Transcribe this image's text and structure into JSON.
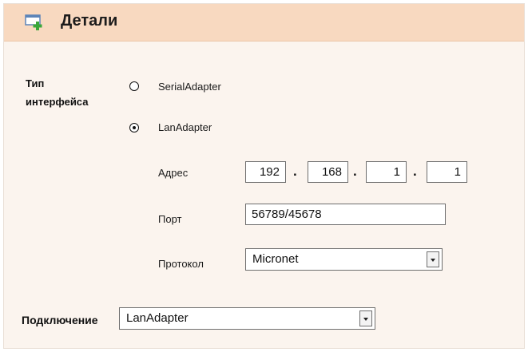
{
  "header": {
    "title": "Детали",
    "icon": "window-add-icon"
  },
  "interface_type": {
    "label_line1": "Тип",
    "label_line2": "интерфейса",
    "options": [
      {
        "label": "SerialAdapter",
        "selected": false
      },
      {
        "label": "LanAdapter",
        "selected": true
      }
    ]
  },
  "lan": {
    "address_label": "Адрес",
    "address": [
      "192",
      "168",
      "1",
      "1"
    ],
    "address_separator": ".",
    "port_label": "Порт",
    "port_value": "56789/45678",
    "protocol_label": "Протокол",
    "protocol_value": "Micronet"
  },
  "connection": {
    "label": "Подключение",
    "value": "LanAdapter"
  },
  "colors": {
    "header_bg": "#f8d9c0",
    "panel_bg": "#fbf4ee",
    "icon_green": "#3aa63a",
    "icon_frame": "#5c84b8"
  }
}
